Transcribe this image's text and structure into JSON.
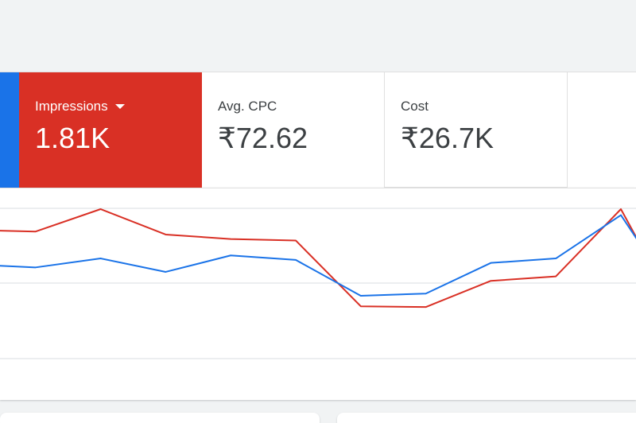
{
  "metrics": {
    "impressions": {
      "label": "Impressions",
      "value": "1.81K",
      "color": "#d93025"
    },
    "avg_cpc": {
      "label": "Avg. CPC",
      "value": "₹72.62"
    },
    "cost": {
      "label": "Cost",
      "value": "₹26.7K"
    },
    "selected_edge_color": "#1a73e8"
  },
  "chart_data": {
    "type": "line",
    "grid": true,
    "ylim": [
      0,
      100
    ],
    "x": [
      0,
      1,
      2,
      3,
      4,
      5,
      6,
      7,
      8,
      9,
      10
    ],
    "series": [
      {
        "color": "#d93025",
        "values": [
          86,
          85,
          100,
          83,
          80,
          79,
          35,
          34.5,
          52,
          55,
          100
        ]
      },
      {
        "color": "#1a73e8",
        "values": [
          63,
          61,
          67,
          58,
          69,
          66,
          42,
          43.5,
          64,
          67,
          96
        ]
      }
    ]
  }
}
